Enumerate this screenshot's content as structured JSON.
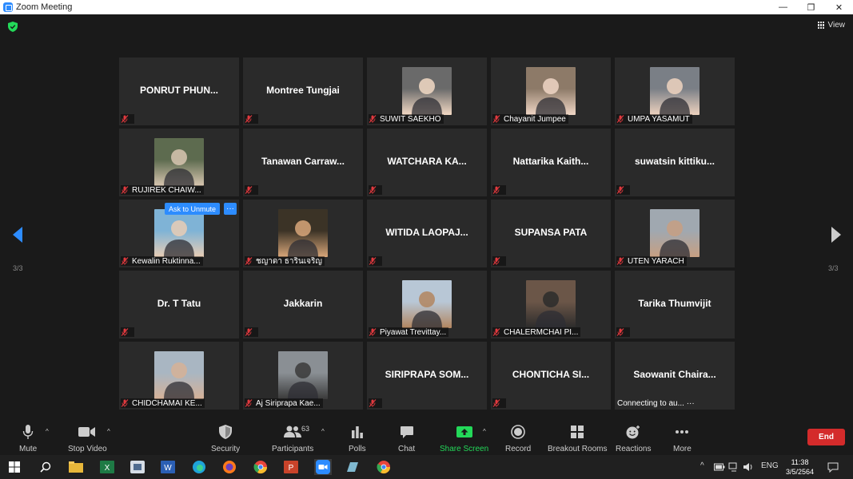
{
  "window": {
    "title": "Zoom Meeting",
    "controls": [
      "—",
      "❐",
      "✕"
    ]
  },
  "view_label": "View",
  "page_indicator": {
    "left": "3/3",
    "right": "3/3"
  },
  "tiles": [
    {
      "name": "PONRUT  PHUN...",
      "label": "",
      "photo": false
    },
    {
      "name": "Montree Tungjai",
      "label": "",
      "photo": false
    },
    {
      "name": "",
      "label": "SUWIT SAEKHO",
      "photo": true,
      "c1": "#6a6a6a",
      "c2": "#f2d9c4"
    },
    {
      "name": "",
      "label": "Chayanit Jumpee",
      "photo": true,
      "c1": "#8d7a68",
      "c2": "#f0d6c5"
    },
    {
      "name": "",
      "label": "UMPA YASAMUT",
      "photo": true,
      "c1": "#7a7f86",
      "c2": "#eed3bf"
    },
    {
      "name": "",
      "label": "RUJIREK CHAIW...",
      "photo": true,
      "c1": "#5d6b4f",
      "c2": "#d8c6b0"
    },
    {
      "name": "Tanawan  Carraw...",
      "label": "",
      "photo": false
    },
    {
      "name": "WATCHARA  KA...",
      "label": "",
      "photo": false
    },
    {
      "name": "Nattarika  Kaith...",
      "label": "",
      "photo": false
    },
    {
      "name": "suwatsin  kittiku...",
      "label": "",
      "photo": false
    },
    {
      "name": "",
      "label": "Kewalin Ruktinna...",
      "photo": true,
      "c1": "#7fb3d6",
      "c2": "#e9cdb5"
    },
    {
      "name": "",
      "label": "ชญาดา ธารินเจริญ",
      "photo": true,
      "c1": "#3b3326",
      "c2": "#d9a77a"
    },
    {
      "name": "WITIDA  LAOPAJ...",
      "label": "",
      "photo": false
    },
    {
      "name": "SUPANSA PATA",
      "label": "",
      "photo": false
    },
    {
      "name": "",
      "label": "UTEN YARACH",
      "photo": true,
      "c1": "#a0a8b0",
      "c2": "#c79f82"
    },
    {
      "name": "Dr. T Tatu",
      "label": "",
      "photo": false
    },
    {
      "name": "Jakkarin",
      "label": "",
      "photo": false
    },
    {
      "name": "",
      "label": "Piyawat Trevittay...",
      "photo": true,
      "c1": "#b8c7d6",
      "c2": "#b2855f"
    },
    {
      "name": "",
      "label": "CHALERMCHAI PI...",
      "photo": true,
      "c1": "#6b5648",
      "c2": "#2b2b2b"
    },
    {
      "name": "Tarika Thumvijit",
      "label": "",
      "photo": false
    },
    {
      "name": "",
      "label": "CHIDCHAMAI KE...",
      "photo": true,
      "c1": "#a9b6c2",
      "c2": "#d6b197"
    },
    {
      "name": "",
      "label": "Aj Siriprapa Kae...",
      "photo": true,
      "c1": "#8a8f94",
      "c2": "#3a3a3a"
    },
    {
      "name": "SIRIPRAPA  SOM...",
      "label": "",
      "photo": false
    },
    {
      "name": "CHONTICHA  SI...",
      "label": "",
      "photo": false
    },
    {
      "name": "Saowanit  Chaira...",
      "label": "Connecting to au... ···",
      "photo": false,
      "connecting": true
    }
  ],
  "ask_unmute": "Ask to Unmute",
  "more_options": "···",
  "toolbar": {
    "mute": "Mute",
    "stop_video": "Stop Video",
    "security": "Security",
    "participants": "Participants",
    "participant_count": "63",
    "polls": "Polls",
    "chat": "Chat",
    "share_screen": "Share Screen",
    "record": "Record",
    "breakout_rooms": "Breakout Rooms",
    "reactions": "Reactions",
    "more": "More",
    "end": "End"
  },
  "taskbar": {
    "language": "ENG",
    "time": "11:38",
    "date": "3/5/2564"
  },
  "colors": {
    "accent": "#2d8cff",
    "end": "#d42b2b",
    "share": "#23d959",
    "muted": "#e0393e"
  }
}
